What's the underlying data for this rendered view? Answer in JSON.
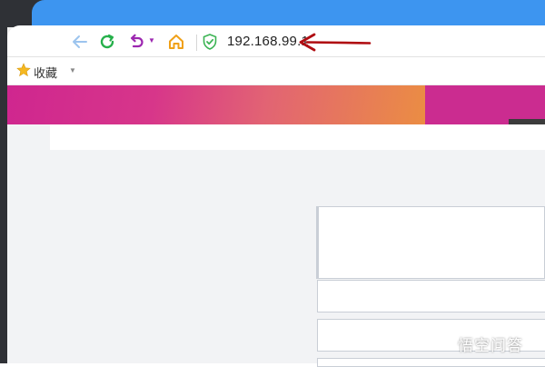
{
  "browser": {
    "address_bar": {
      "url": "192.168.99.1"
    },
    "bookmarks_bar": {
      "label": "收藏"
    }
  },
  "icons": {
    "back": "arrow-left-icon",
    "reload": "refresh-icon",
    "undo": "undo-icon",
    "home": "home-icon",
    "security": "shield-check-icon",
    "bookmark": "star-icon",
    "annotation": "red-arrow-icon"
  },
  "colors": {
    "tab_strip": "#3d95f0",
    "reload_green": "#26b04b",
    "undo_purple": "#9c27b0",
    "home_orange": "#f0a017",
    "shield_green": "#3cb454",
    "annotation_red": "#b00d12",
    "banner_start": "#cf268f",
    "banner_end": "#eb8d43"
  },
  "watermark": {
    "text": "悟空问答"
  }
}
